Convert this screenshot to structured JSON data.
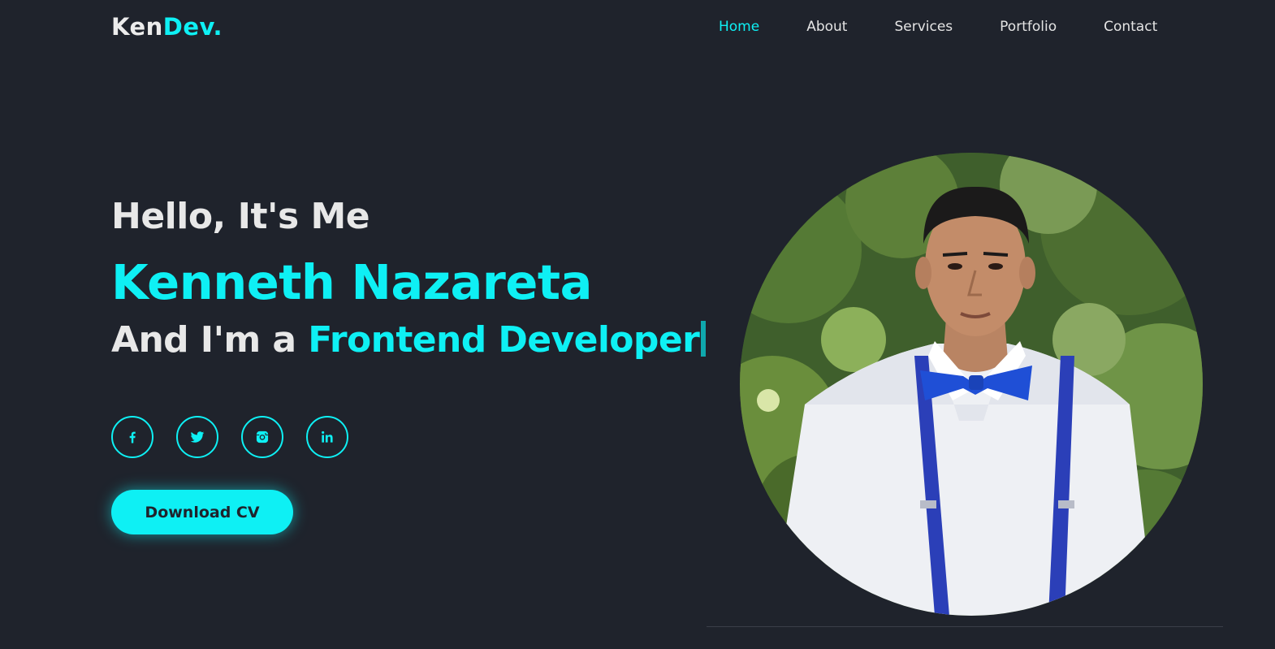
{
  "logo": {
    "text": "Ken",
    "accent": "Dev."
  },
  "nav": {
    "items": [
      {
        "label": "Home",
        "active": true
      },
      {
        "label": "About"
      },
      {
        "label": "Services"
      },
      {
        "label": "Portfolio"
      },
      {
        "label": "Contact"
      }
    ]
  },
  "hero": {
    "greeting": "Hello, It's Me",
    "name": "Kenneth Nazareta",
    "role_prefix": "And I'm a",
    "role": "Frontend Developer"
  },
  "socials": [
    {
      "icon": "facebook-icon"
    },
    {
      "icon": "twitter-icon"
    },
    {
      "icon": "instagram-icon"
    },
    {
      "icon": "linkedin-icon"
    }
  ],
  "cta": {
    "label": "Download CV"
  },
  "colors": {
    "background": "#1f232c",
    "accent": "#0ef0f4",
    "text": "#e8e8e8"
  }
}
